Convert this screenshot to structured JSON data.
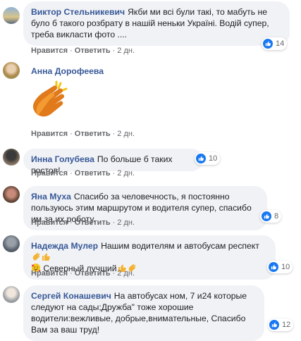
{
  "comments": [
    {
      "author": "Виктор Стельникевич",
      "text": "Якби ми всі були такі, то мабуть не було б такого розбрату в нашій неньки Україні. Водій супер, треба викласти фото ....",
      "like": "Нравится",
      "reply": "Ответить",
      "time": "2 дн.",
      "reactions": "14"
    },
    {
      "author": "Анна Дорофеева",
      "text": "",
      "like": "Нравится",
      "reply": "Ответить",
      "time": "2 дн.",
      "reactions": ""
    },
    {
      "author": "Инна Голубева",
      "text": "По больше б таких постов!",
      "like": "Нравится",
      "reply": "Ответить",
      "time": "2 дн.",
      "reactions": "10"
    },
    {
      "author": "Яна Муха",
      "text": "Спасибо за человечность, я постоянно пользуюсь этим маршрутом и водителя супер, спасибо им за их роботу.",
      "like": "Нравится",
      "reply": "Ответить",
      "time": "2 дн.",
      "reactions": "8"
    },
    {
      "author": "Надежда Мулер",
      "text": "Нашим водителям и автобусам респект",
      "text2": "Северный лучший",
      "like": "Нравится",
      "reply": "Ответить",
      "time": "2 дн.",
      "reactions": "10"
    },
    {
      "author": "Сергей Конашевич",
      "text": "На автобусах ном, 7 и24 которые следуют на сады;Дружба\" тоже хорошие водители:вежливые, добрые,внимательные, Спасибо Вам за ваш труд!",
      "like": "Нравится",
      "reply": "Ответить",
      "time": "2 дн.",
      "reactions": "12"
    }
  ],
  "separator": "·",
  "colors": {
    "author": "#385898",
    "bubble": "#f0f2f5",
    "like": "#1877f2"
  },
  "icons": [
    "like-icon",
    "clapping-hands-icon",
    "face-with-hearts-icon",
    "thumbs-up-icon"
  ]
}
